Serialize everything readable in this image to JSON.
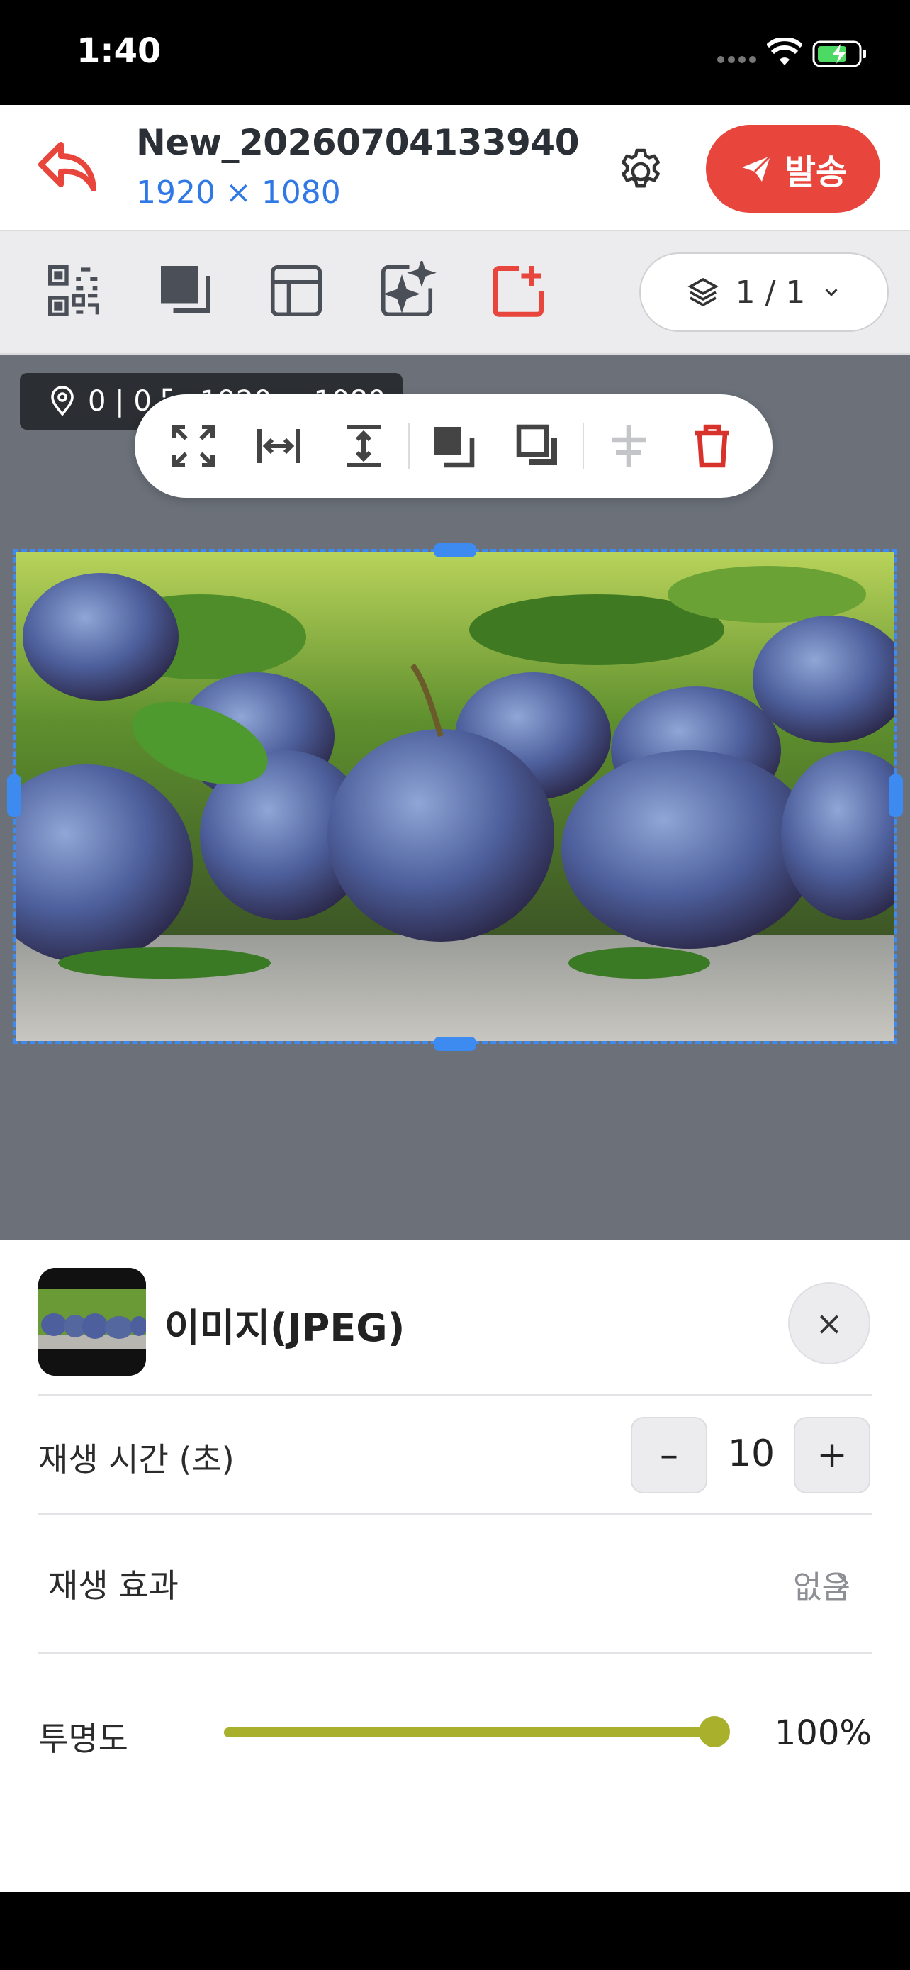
{
  "status_bar": {
    "time": "1:40"
  },
  "header": {
    "title": "New_20260704133940",
    "resolution": "1920 × 1080",
    "send_label": "발송"
  },
  "toolbar": {
    "layer_indicator": "1 / 1"
  },
  "canvas": {
    "coords": "0 | 0",
    "size_text": "1920 × 1080"
  },
  "sheet": {
    "title": "이미지(JPEG)",
    "close_label": "×",
    "duration_label": "재생 시간 (초)",
    "duration_minus": "–",
    "duration_value": "10",
    "duration_plus": "+",
    "effect_label": "재생 효과",
    "effect_value": "없음",
    "opacity_label": "투명도",
    "opacity_value": "100%",
    "opacity_level": 1.0
  },
  "colors": {
    "accent_red": "#e8453c",
    "accent_blue": "#2f78e6",
    "slider": "#a8b02c"
  }
}
